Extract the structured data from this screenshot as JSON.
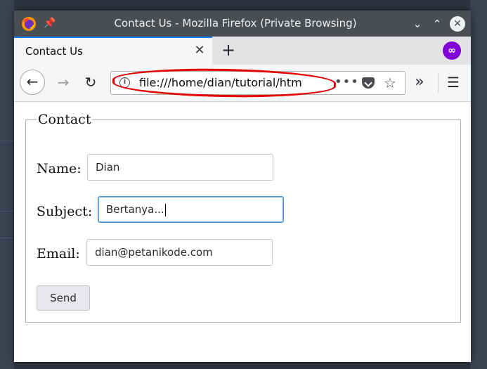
{
  "window": {
    "title": "Contact Us - Mozilla Firefox (Private Browsing)",
    "min_icon": "⌄",
    "max_icon": "⌃",
    "close_icon": "✕",
    "pin_icon": "📌"
  },
  "tabs": [
    {
      "label": "Contact Us",
      "close_icon": "✕",
      "active": true
    }
  ],
  "toolbar": {
    "new_tab_icon": "+",
    "private_icon": "∞",
    "back_icon": "←",
    "forward_icon": "→",
    "reload_icon": "↻",
    "url": "file:///home/dian/tutorial/htm",
    "page_actions_icon": "•••",
    "bookmark_icon": "☆",
    "overflow_icon": "»",
    "menu_icon": "☰",
    "info_icon": "i"
  },
  "form": {
    "legend": "Contact",
    "name_label": "Name:",
    "name_value": "Dian",
    "subject_label": "Subject:",
    "subject_value": "Bertanya...",
    "email_label": "Email:",
    "email_value": "dian@petanikode.com",
    "send_label": "Send"
  },
  "colors": {
    "titlebar": "#4a4d51",
    "accent": "#0a84ff",
    "private": "#8000d7",
    "highlight": "#e30000",
    "focus_border": "#4a90d9"
  }
}
